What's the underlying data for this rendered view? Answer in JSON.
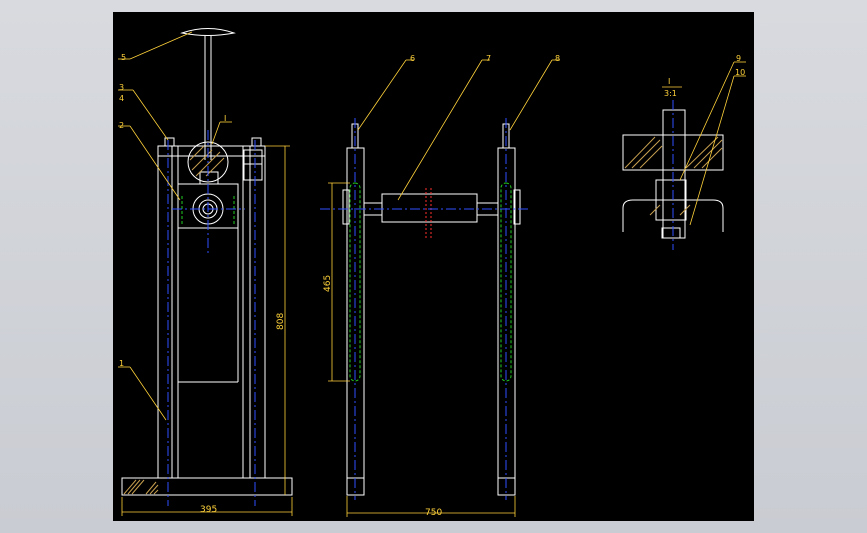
{
  "drawing": {
    "background": "#000000",
    "frame_color": "#c9ccd2",
    "colors": {
      "outline": "#ffffff",
      "leader": "#ffd23a",
      "centerline": "#3050ff",
      "hidden": "#22cc22",
      "hatch": "#c8a050",
      "cut": "#ff3030"
    },
    "part_labels": [
      "1",
      "2",
      "3",
      "4",
      "5",
      "6",
      "7",
      "8",
      "9",
      "10"
    ],
    "detail_mark": "I",
    "detail_scale": {
      "top": "I",
      "bottom": "3:1"
    },
    "dimensions": {
      "overall_height": "808",
      "base_width": "395",
      "span": "750",
      "column_length": "465"
    }
  }
}
